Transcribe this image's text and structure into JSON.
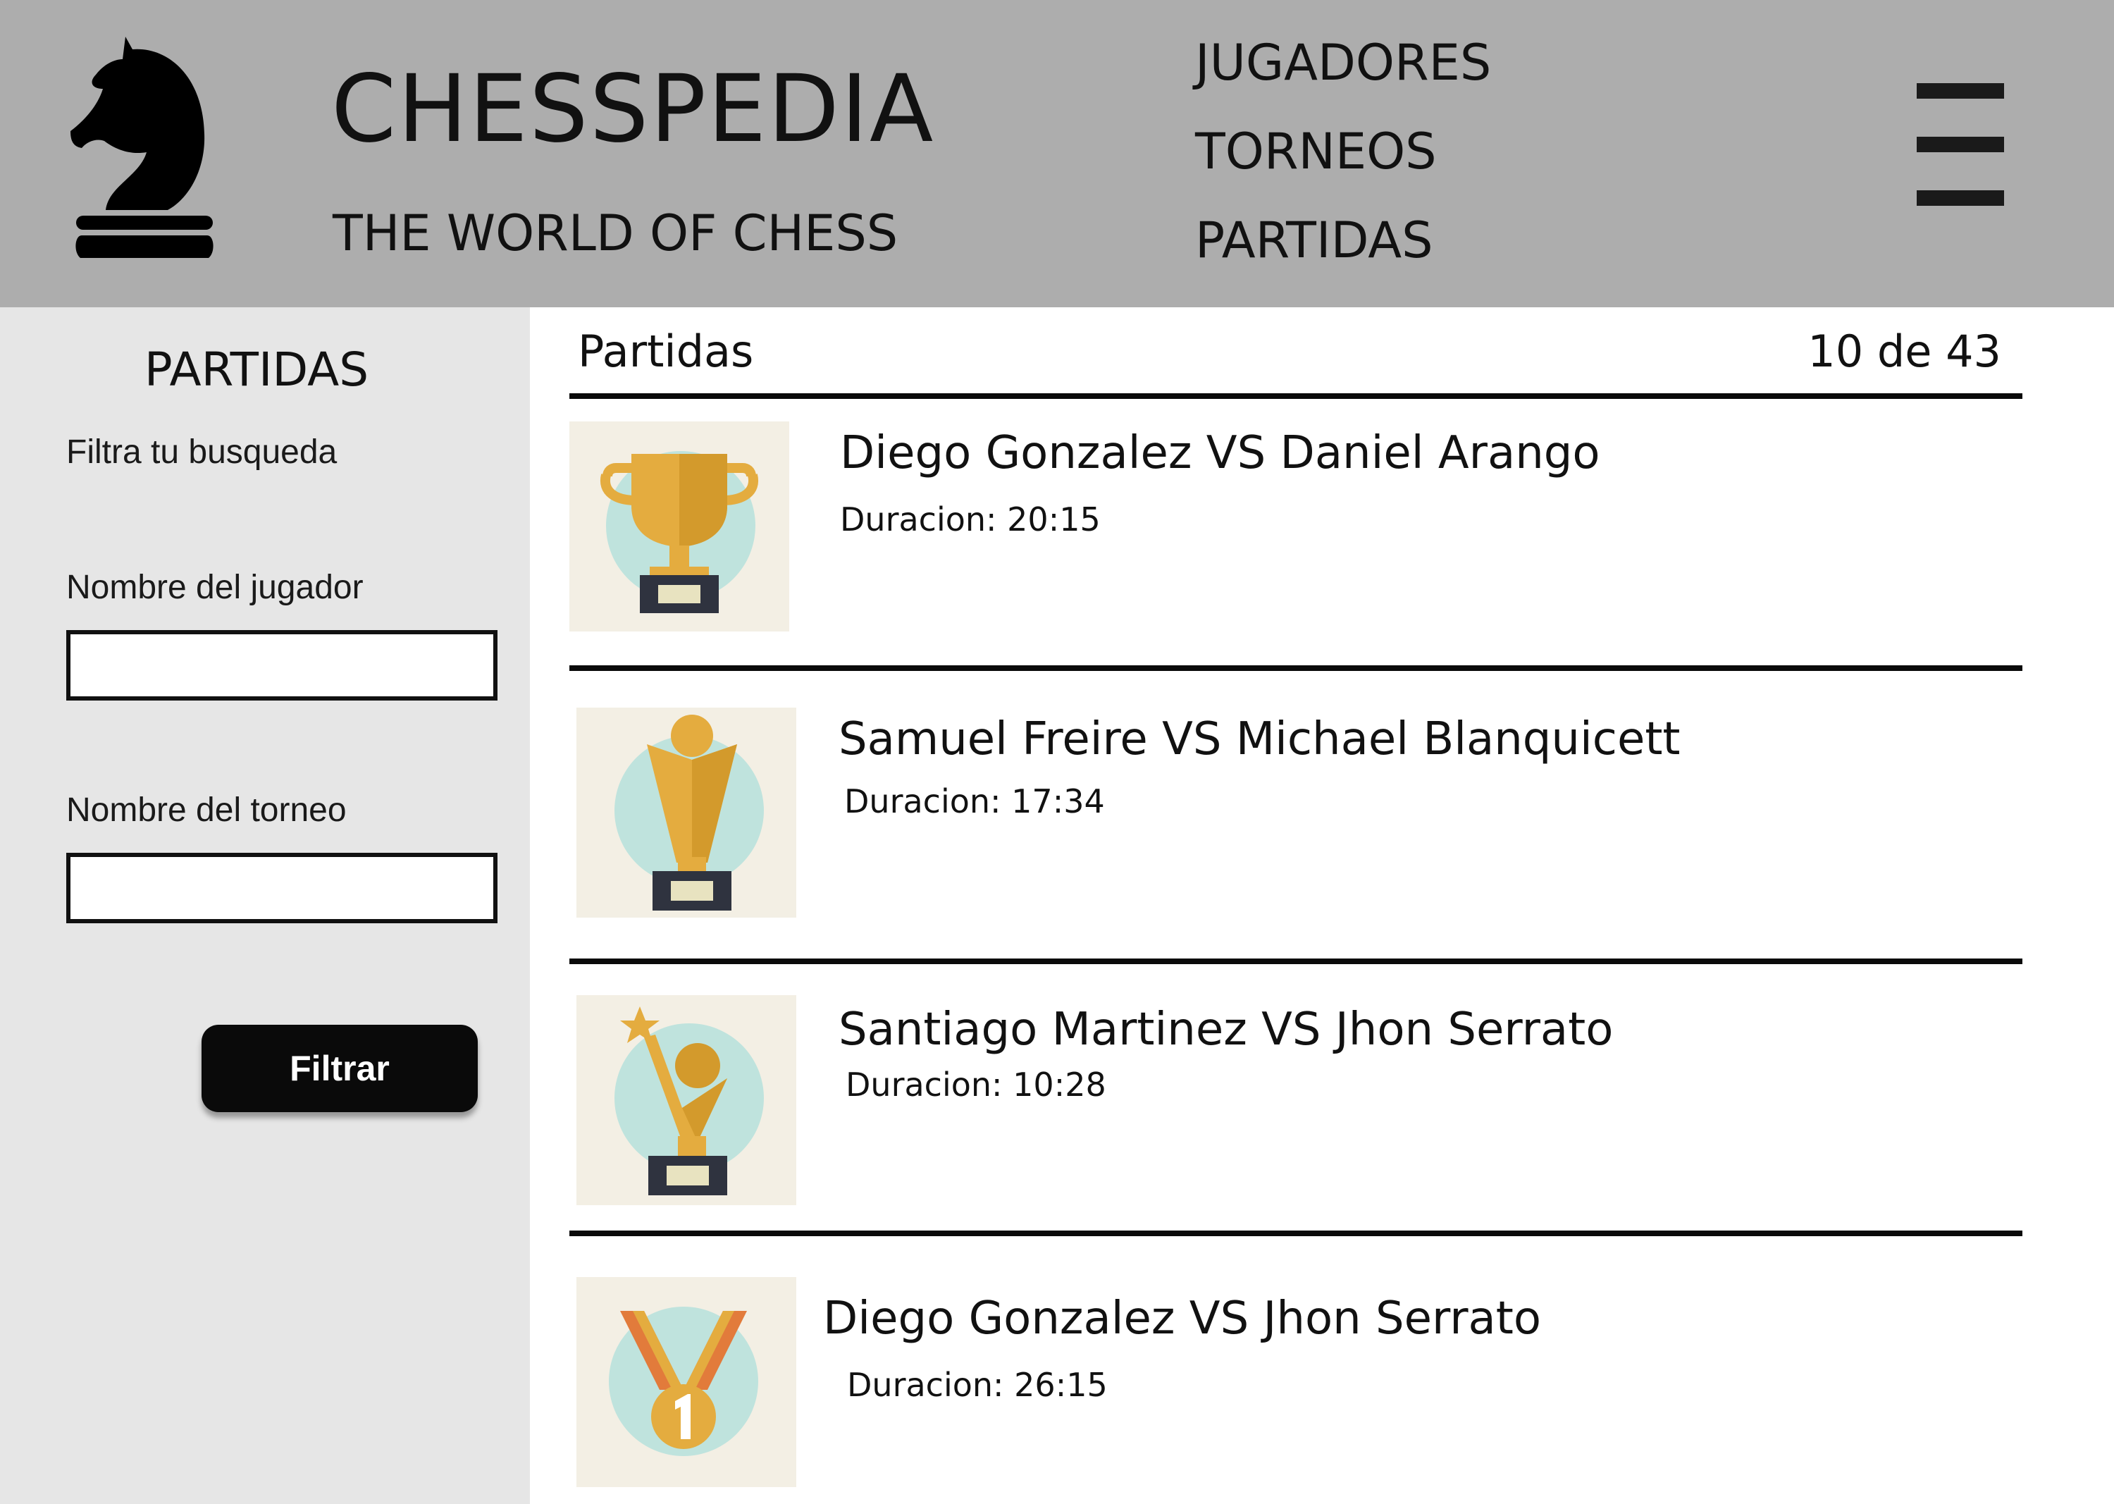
{
  "header": {
    "brand": "CHESSPEDIA",
    "tagline": "THE WORLD OF CHESS",
    "nav": [
      "JUGADORES",
      "TORNEOS",
      "PARTIDAS"
    ],
    "logo_icon": "chess-knight-icon",
    "menu_icon": "hamburger-menu-icon"
  },
  "sidebar": {
    "title": "PARTIDAS",
    "subtitle": "Filtra tu busqueda",
    "player_label": "Nombre del jugador",
    "player_value": "",
    "tournament_label": "Nombre del torneo",
    "tournament_value": "",
    "filter_button": "Filtrar"
  },
  "list": {
    "title": "Partidas",
    "count": "10 de 43",
    "items": [
      {
        "title": "Diego Gonzalez VS Daniel Arango",
        "duration": "Duracion: 20:15",
        "icon": "trophy-cup-icon"
      },
      {
        "title": "Samuel Freire VS Michael Blanquicett",
        "duration": "Duracion: 17:34",
        "icon": "trophy-ball-icon"
      },
      {
        "title": "Santiago Martinez VS Jhon Serrato",
        "duration": "Duracion: 10:28",
        "icon": "trophy-star-icon"
      },
      {
        "title": "Diego Gonzalez VS Jhon Serrato",
        "duration": "Duracion: 26:15",
        "icon": "medal-first-place-icon"
      }
    ]
  },
  "colors": {
    "header_bg": "#adadad",
    "sidebar_bg": "#e6e6e6",
    "gold": "#e4ac3f",
    "gold_dark": "#d39a2c",
    "mint": "#bfe3dd",
    "thumb_bg": "#f3efe4"
  }
}
